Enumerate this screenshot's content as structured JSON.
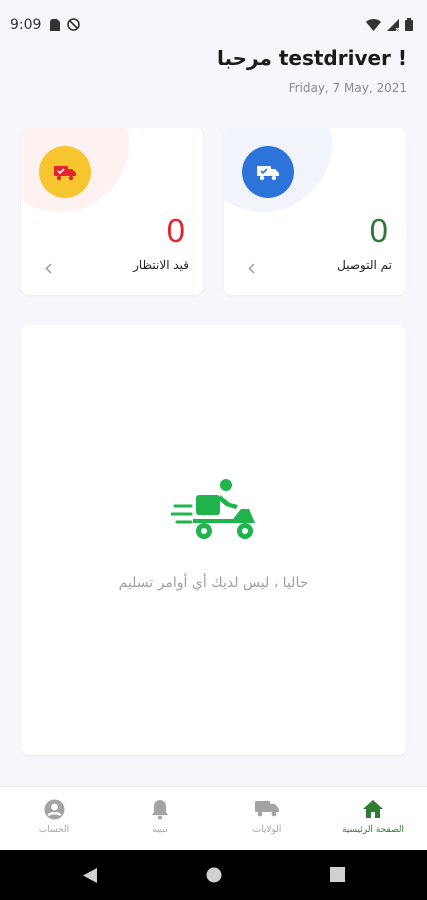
{
  "status_bar": {
    "time": "9:09",
    "icons": [
      "sim-card-icon",
      "do-not-disturb-icon",
      "wifi-icon",
      "signal-icon",
      "battery-icon"
    ]
  },
  "header": {
    "greeting": "مرحبا testdriver !",
    "date": "Friday, 7 May, 2021"
  },
  "stats": {
    "delivered": {
      "value": "0",
      "label": "تم التوصيل",
      "icon": "delivered-truck-icon",
      "color": "#2d74da",
      "value_color": "#2f7a32"
    },
    "pending": {
      "value": "0",
      "label": "قيد الانتظار",
      "icon": "pending-truck-icon",
      "color": "#f7c52d",
      "value_color": "#e4252f"
    }
  },
  "main": {
    "empty_message": "حاليا ، ليس لديك أي أوامر تسليم",
    "illustration": "delivery-scooter-icon",
    "accent": "#1fb44c"
  },
  "bottom_nav": {
    "items": [
      {
        "label": "الصفحة الرئيسية",
        "icon": "home-icon",
        "active": true
      },
      {
        "label": "الولايات",
        "icon": "truck-icon",
        "active": false
      },
      {
        "label": "تنبيه",
        "icon": "bell-icon",
        "active": false
      },
      {
        "label": "الحساب",
        "icon": "account-icon",
        "active": false
      }
    ],
    "active_color": "#2e7d32"
  },
  "android_nav": {
    "buttons": [
      "back-icon",
      "home-circle-icon",
      "recents-icon"
    ]
  }
}
